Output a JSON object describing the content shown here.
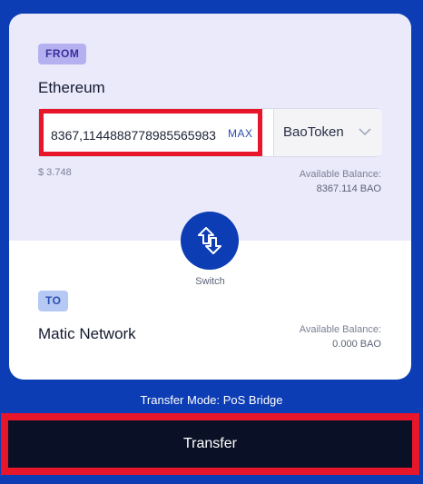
{
  "from": {
    "badge": "FROM",
    "network": "Ethereum",
    "amount_value": "8367,1144888778985565983",
    "max_label": "MAX",
    "token": "BaoToken",
    "usd_value": "$ 3.748",
    "balance_label": "Available Balance:",
    "balance_amount": "8367.114 BAO"
  },
  "switch": {
    "label": "Switch",
    "icon": "swap-arrows-icon"
  },
  "to": {
    "badge": "TO",
    "network": "Matic Network",
    "balance_label": "Available Balance:",
    "balance_amount": "0.000 BAO"
  },
  "transfer_mode": "Transfer Mode: PoS Bridge",
  "transfer_button": "Transfer",
  "colors": {
    "background": "#0c3db4",
    "from_panel": "#ebeafb",
    "highlight": "#e8162a",
    "button": "#0a1126"
  }
}
